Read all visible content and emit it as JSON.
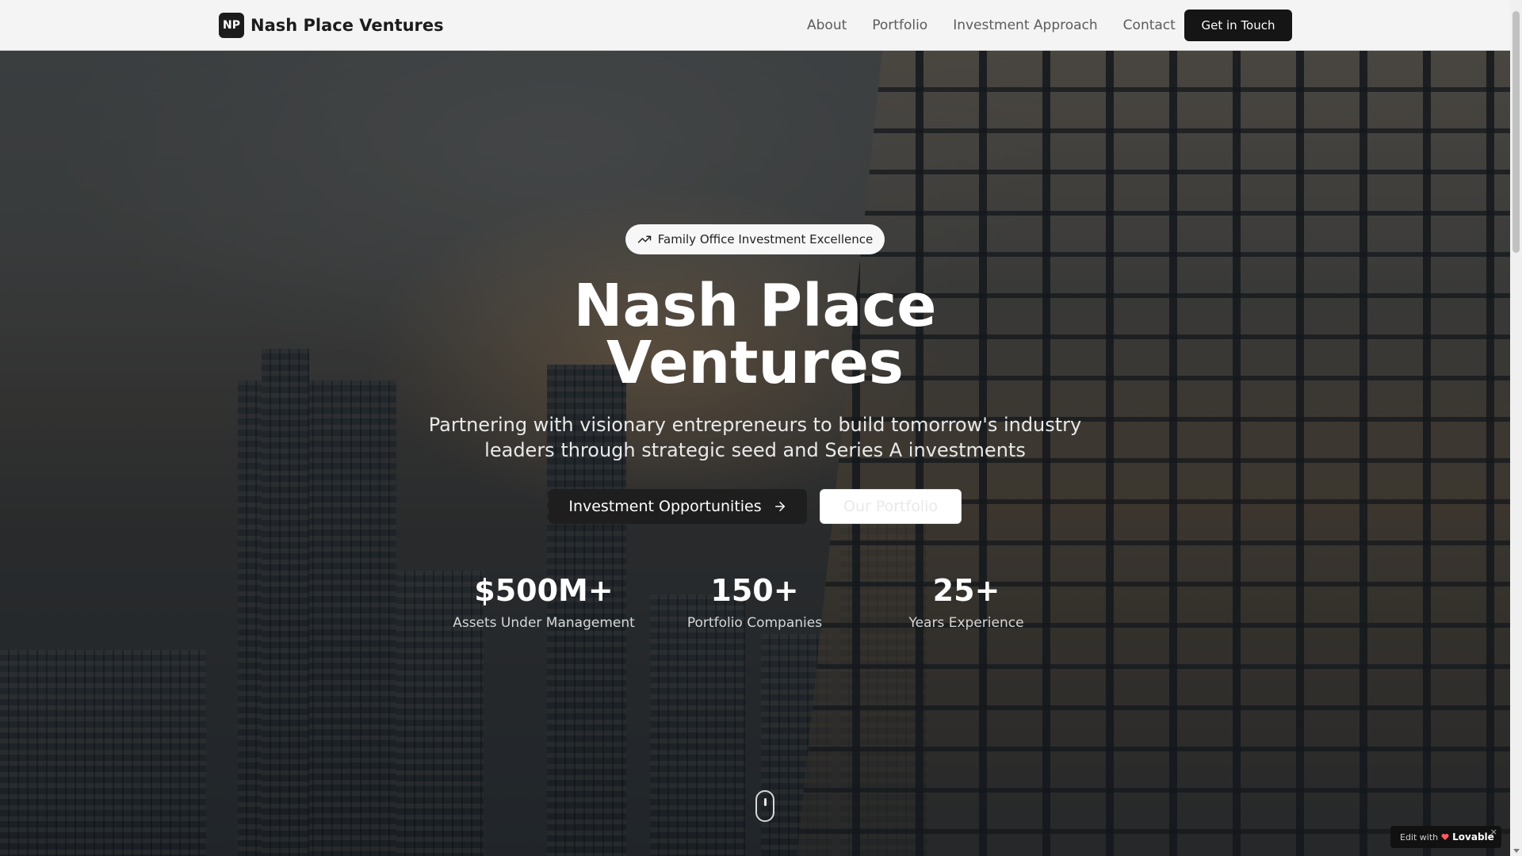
{
  "navbar": {
    "brand_badge": "NP",
    "brand_name": "Nash Place Ventures",
    "links": [
      "About",
      "Portfolio",
      "Investment Approach",
      "Contact"
    ],
    "cta_label": "Get in Touch"
  },
  "hero": {
    "pill_text": "Family Office Investment Excellence",
    "pill_icon": "trending-up-icon",
    "title_line1": "Nash Place",
    "title_line2": "Ventures",
    "subtitle": "Partnering with visionary entrepreneurs to build tomorrow's industry leaders through strategic seed and Series A investments",
    "primary_button": "Investment Opportunities",
    "primary_button_icon": "arrow-right-icon",
    "secondary_button": "Our Portfolio",
    "stats": [
      {
        "value": "$500M+",
        "label": "Assets Under Management"
      },
      {
        "value": "150+",
        "label": "Portfolio Companies"
      },
      {
        "value": "25+",
        "label": "Years Experience"
      }
    ]
  },
  "lovable_badge": {
    "edit_text": "Edit with",
    "brand": "Lovable",
    "close": "×"
  },
  "colors": {
    "primary_dark": "#151515",
    "nav_background": "#f4f4f4",
    "nav_link": "#5b5b5b",
    "white": "#ffffff"
  }
}
